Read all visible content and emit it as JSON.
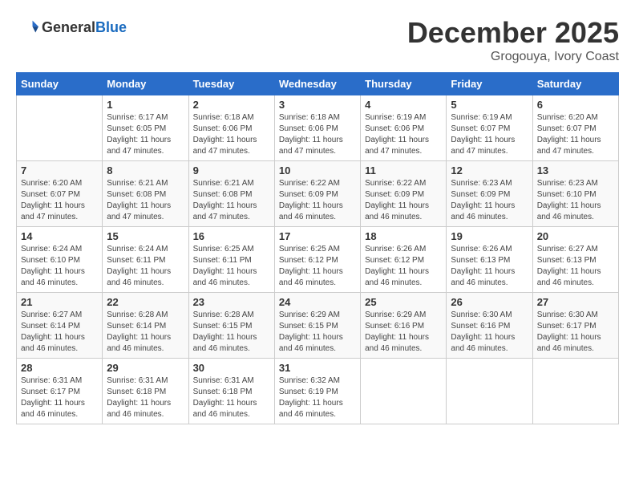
{
  "logo": {
    "general": "General",
    "blue": "Blue"
  },
  "title": {
    "month": "December 2025",
    "location": "Grogouya, Ivory Coast"
  },
  "headers": [
    "Sunday",
    "Monday",
    "Tuesday",
    "Wednesday",
    "Thursday",
    "Friday",
    "Saturday"
  ],
  "weeks": [
    [
      {
        "day": "",
        "info": ""
      },
      {
        "day": "1",
        "info": "Sunrise: 6:17 AM\nSunset: 6:05 PM\nDaylight: 11 hours and 47 minutes."
      },
      {
        "day": "2",
        "info": "Sunrise: 6:18 AM\nSunset: 6:06 PM\nDaylight: 11 hours and 47 minutes."
      },
      {
        "day": "3",
        "info": "Sunrise: 6:18 AM\nSunset: 6:06 PM\nDaylight: 11 hours and 47 minutes."
      },
      {
        "day": "4",
        "info": "Sunrise: 6:19 AM\nSunset: 6:06 PM\nDaylight: 11 hours and 47 minutes."
      },
      {
        "day": "5",
        "info": "Sunrise: 6:19 AM\nSunset: 6:07 PM\nDaylight: 11 hours and 47 minutes."
      },
      {
        "day": "6",
        "info": "Sunrise: 6:20 AM\nSunset: 6:07 PM\nDaylight: 11 hours and 47 minutes."
      }
    ],
    [
      {
        "day": "7",
        "info": "Sunrise: 6:20 AM\nSunset: 6:07 PM\nDaylight: 11 hours and 47 minutes."
      },
      {
        "day": "8",
        "info": "Sunrise: 6:21 AM\nSunset: 6:08 PM\nDaylight: 11 hours and 47 minutes."
      },
      {
        "day": "9",
        "info": "Sunrise: 6:21 AM\nSunset: 6:08 PM\nDaylight: 11 hours and 47 minutes."
      },
      {
        "day": "10",
        "info": "Sunrise: 6:22 AM\nSunset: 6:09 PM\nDaylight: 11 hours and 46 minutes."
      },
      {
        "day": "11",
        "info": "Sunrise: 6:22 AM\nSunset: 6:09 PM\nDaylight: 11 hours and 46 minutes."
      },
      {
        "day": "12",
        "info": "Sunrise: 6:23 AM\nSunset: 6:09 PM\nDaylight: 11 hours and 46 minutes."
      },
      {
        "day": "13",
        "info": "Sunrise: 6:23 AM\nSunset: 6:10 PM\nDaylight: 11 hours and 46 minutes."
      }
    ],
    [
      {
        "day": "14",
        "info": "Sunrise: 6:24 AM\nSunset: 6:10 PM\nDaylight: 11 hours and 46 minutes."
      },
      {
        "day": "15",
        "info": "Sunrise: 6:24 AM\nSunset: 6:11 PM\nDaylight: 11 hours and 46 minutes."
      },
      {
        "day": "16",
        "info": "Sunrise: 6:25 AM\nSunset: 6:11 PM\nDaylight: 11 hours and 46 minutes."
      },
      {
        "day": "17",
        "info": "Sunrise: 6:25 AM\nSunset: 6:12 PM\nDaylight: 11 hours and 46 minutes."
      },
      {
        "day": "18",
        "info": "Sunrise: 6:26 AM\nSunset: 6:12 PM\nDaylight: 11 hours and 46 minutes."
      },
      {
        "day": "19",
        "info": "Sunrise: 6:26 AM\nSunset: 6:13 PM\nDaylight: 11 hours and 46 minutes."
      },
      {
        "day": "20",
        "info": "Sunrise: 6:27 AM\nSunset: 6:13 PM\nDaylight: 11 hours and 46 minutes."
      }
    ],
    [
      {
        "day": "21",
        "info": "Sunrise: 6:27 AM\nSunset: 6:14 PM\nDaylight: 11 hours and 46 minutes."
      },
      {
        "day": "22",
        "info": "Sunrise: 6:28 AM\nSunset: 6:14 PM\nDaylight: 11 hours and 46 minutes."
      },
      {
        "day": "23",
        "info": "Sunrise: 6:28 AM\nSunset: 6:15 PM\nDaylight: 11 hours and 46 minutes."
      },
      {
        "day": "24",
        "info": "Sunrise: 6:29 AM\nSunset: 6:15 PM\nDaylight: 11 hours and 46 minutes."
      },
      {
        "day": "25",
        "info": "Sunrise: 6:29 AM\nSunset: 6:16 PM\nDaylight: 11 hours and 46 minutes."
      },
      {
        "day": "26",
        "info": "Sunrise: 6:30 AM\nSunset: 6:16 PM\nDaylight: 11 hours and 46 minutes."
      },
      {
        "day": "27",
        "info": "Sunrise: 6:30 AM\nSunset: 6:17 PM\nDaylight: 11 hours and 46 minutes."
      }
    ],
    [
      {
        "day": "28",
        "info": "Sunrise: 6:31 AM\nSunset: 6:17 PM\nDaylight: 11 hours and 46 minutes."
      },
      {
        "day": "29",
        "info": "Sunrise: 6:31 AM\nSunset: 6:18 PM\nDaylight: 11 hours and 46 minutes."
      },
      {
        "day": "30",
        "info": "Sunrise: 6:31 AM\nSunset: 6:18 PM\nDaylight: 11 hours and 46 minutes."
      },
      {
        "day": "31",
        "info": "Sunrise: 6:32 AM\nSunset: 6:19 PM\nDaylight: 11 hours and 46 minutes."
      },
      {
        "day": "",
        "info": ""
      },
      {
        "day": "",
        "info": ""
      },
      {
        "day": "",
        "info": ""
      }
    ]
  ]
}
